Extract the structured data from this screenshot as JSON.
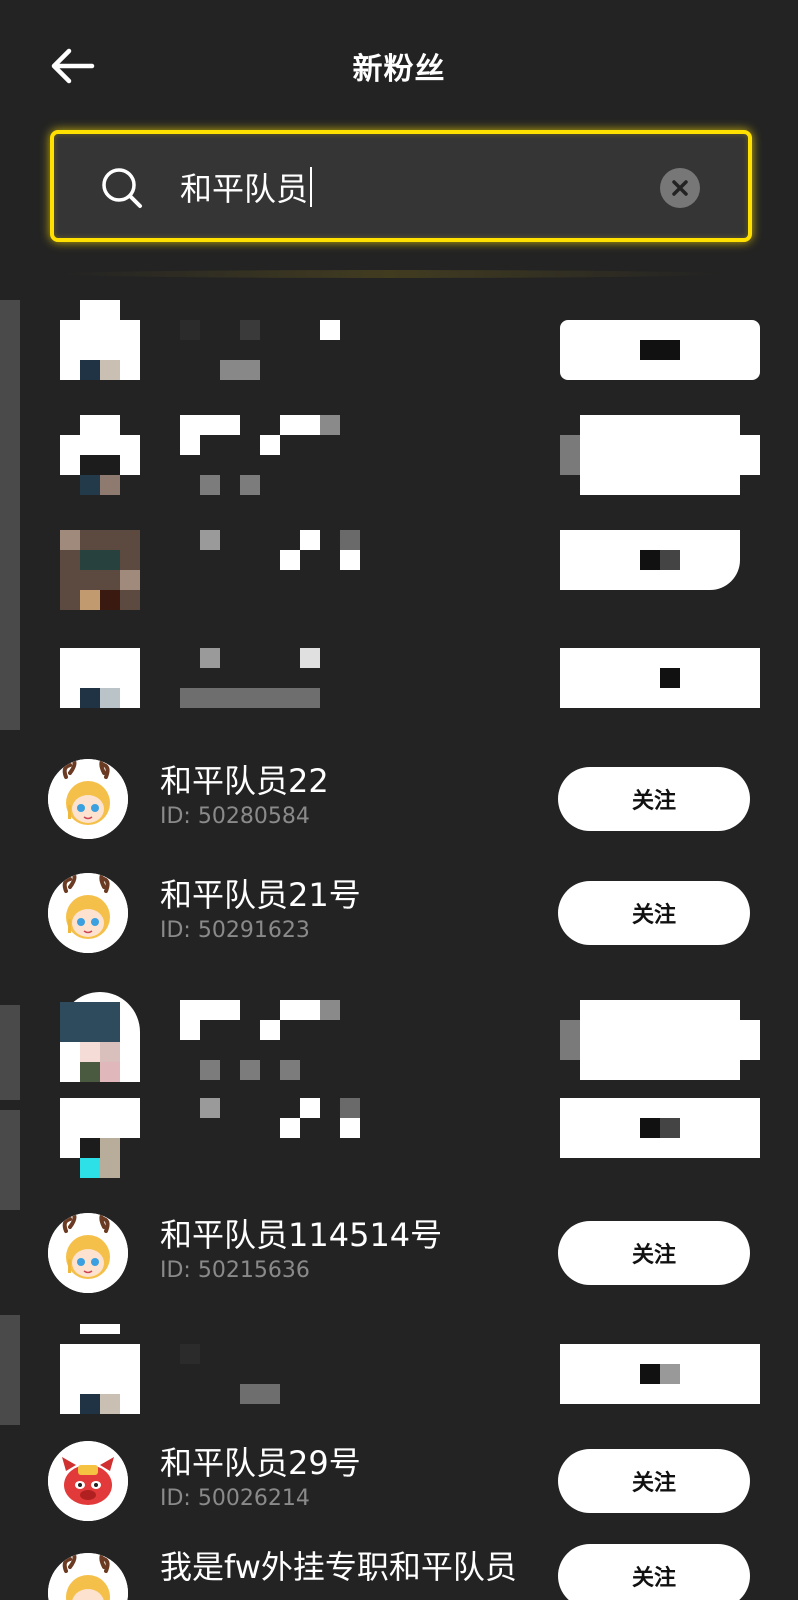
{
  "header": {
    "title": "新粉丝"
  },
  "search": {
    "query": "和平队员"
  },
  "follow_label": "关注",
  "users": [
    {
      "name": "和平队员22",
      "id": "ID: 50280584"
    },
    {
      "name": "和平队员21号",
      "id": "ID: 50291623"
    },
    {
      "name": "和平队员114514号",
      "id": "ID: 50215636"
    },
    {
      "name": "和平队员29号",
      "id": "ID: 50026214"
    },
    {
      "name": "我是fw外挂专职和平队员",
      "id": ""
    }
  ],
  "colors": {
    "background": "#232323",
    "accent": "#ffe000",
    "button": "#ffffff",
    "muted": "#8a8a8a"
  }
}
